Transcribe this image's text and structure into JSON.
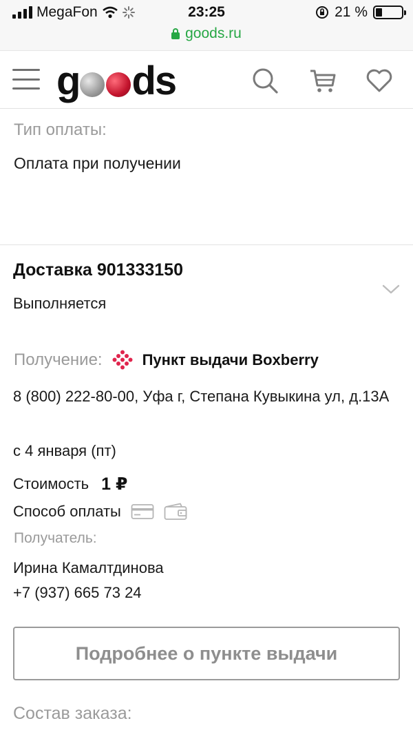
{
  "status_bar": {
    "carrier": "MegaFon",
    "time": "23:25",
    "battery_percent": "21 %",
    "battery_level": 0.21
  },
  "url_bar": {
    "domain": "goods.ru"
  },
  "header": {
    "logo_text_start": "g",
    "logo_text_end": "ds",
    "icons": [
      "menu-icon",
      "search-icon",
      "cart-icon",
      "heart-icon"
    ]
  },
  "payment": {
    "label": "Тип оплаты:",
    "value": "Оплата при получении"
  },
  "delivery": {
    "title": "Доставка 901333150",
    "status": "Выполняется",
    "receive_label": "Получение:",
    "pickup_name": "Пункт выдачи Boxberry",
    "address": "8 (800) 222-80-00, Уфа г, Степана Кувыкина ул, д.13А",
    "date": "с 4 января (пт)",
    "cost_label": "Стоимость",
    "cost_value": "1 ₽",
    "payment_method_label": "Способ оплаты",
    "recipient_label": "Получатель:",
    "recipient_name": "Ирина Камалтдинова",
    "recipient_phone": "+7 (937) 665 73 24",
    "details_button": "Подробнее о пункте выдачи"
  },
  "order": {
    "composition_label": "Состав заказа:"
  },
  "colors": {
    "accent_green": "#27a745",
    "boxberry_red": "#e0254d",
    "muted_grey": "#9a9a9a"
  }
}
